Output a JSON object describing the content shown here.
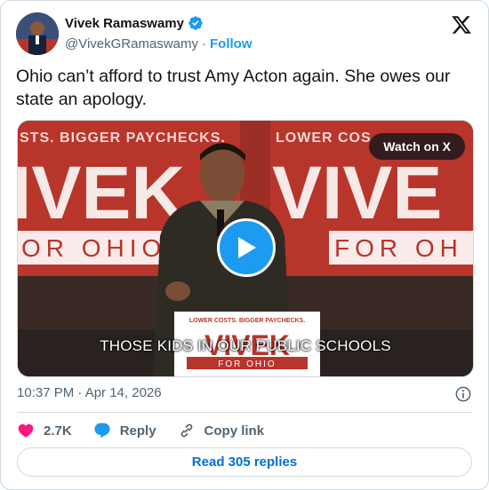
{
  "author": {
    "display_name": "Vivek Ramaswamy",
    "handle": "@VivekGRamaswamy",
    "separator": "·",
    "follow_label": "Follow"
  },
  "tweet": {
    "text": "Ohio can’t afford to trust Amy Acton again. She owes our state an apology.",
    "timestamp": "10:37 PM · Apr 14, 2026"
  },
  "media": {
    "watch_label": "Watch on X",
    "caption": "THOSE KIDS IN OUR PUBLIC SCHOOLS",
    "banner_left_top": "STS. BIGGER PAYCHECKS.",
    "banner_left_big": "IVEK",
    "banner_left_sub": "OR OHIO",
    "banner_right_top": "LOWER COS",
    "banner_right_big": "VIVE",
    "banner_right_sub": "FOR OH",
    "podium_top": "LOWER COSTS. BIGGER PAYCHECKS.",
    "podium_big": "VIVEK",
    "podium_sub": "FOR OHIO"
  },
  "actions": {
    "like_count": "2.7K",
    "reply_label": "Reply",
    "copy_label": "Copy link",
    "read_replies_label": "Read 305 replies"
  },
  "colors": {
    "accent": "#1d9bf0",
    "like": "#f91880",
    "link": "#006fd6",
    "banner_red": "#b8352b"
  }
}
